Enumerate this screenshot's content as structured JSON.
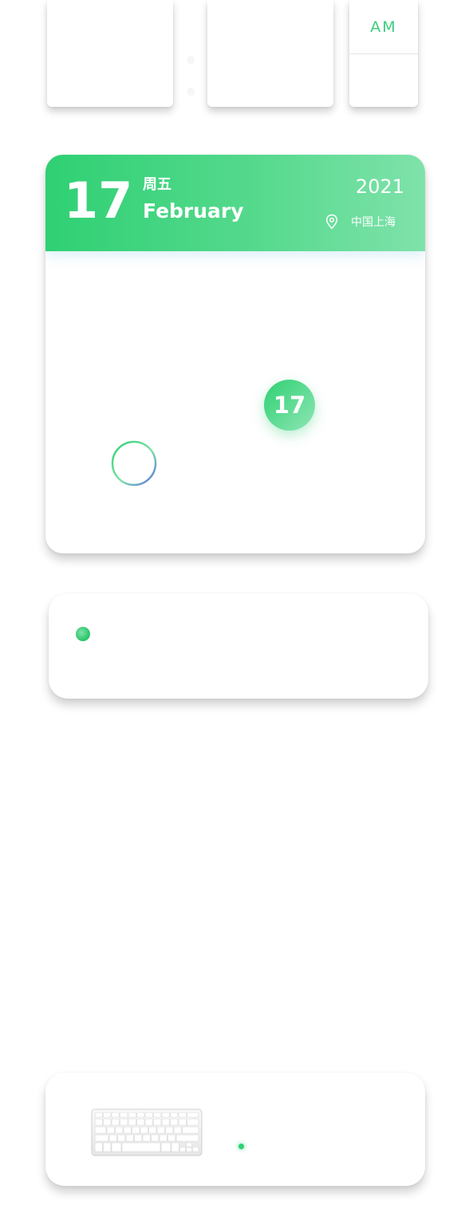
{
  "clock": {
    "period_label": "AM"
  },
  "calendar": {
    "day": "17",
    "weekday": "周五",
    "month": "February",
    "year": "2021",
    "location": "中国上海",
    "selected_day": "17"
  },
  "colors": {
    "accent": "#2fd073",
    "accent_light": "#7fe2aa",
    "ring_end": "#5b6ee0"
  },
  "icons": {
    "location": "location-pin-icon",
    "keyboard": "keyboard-icon"
  }
}
